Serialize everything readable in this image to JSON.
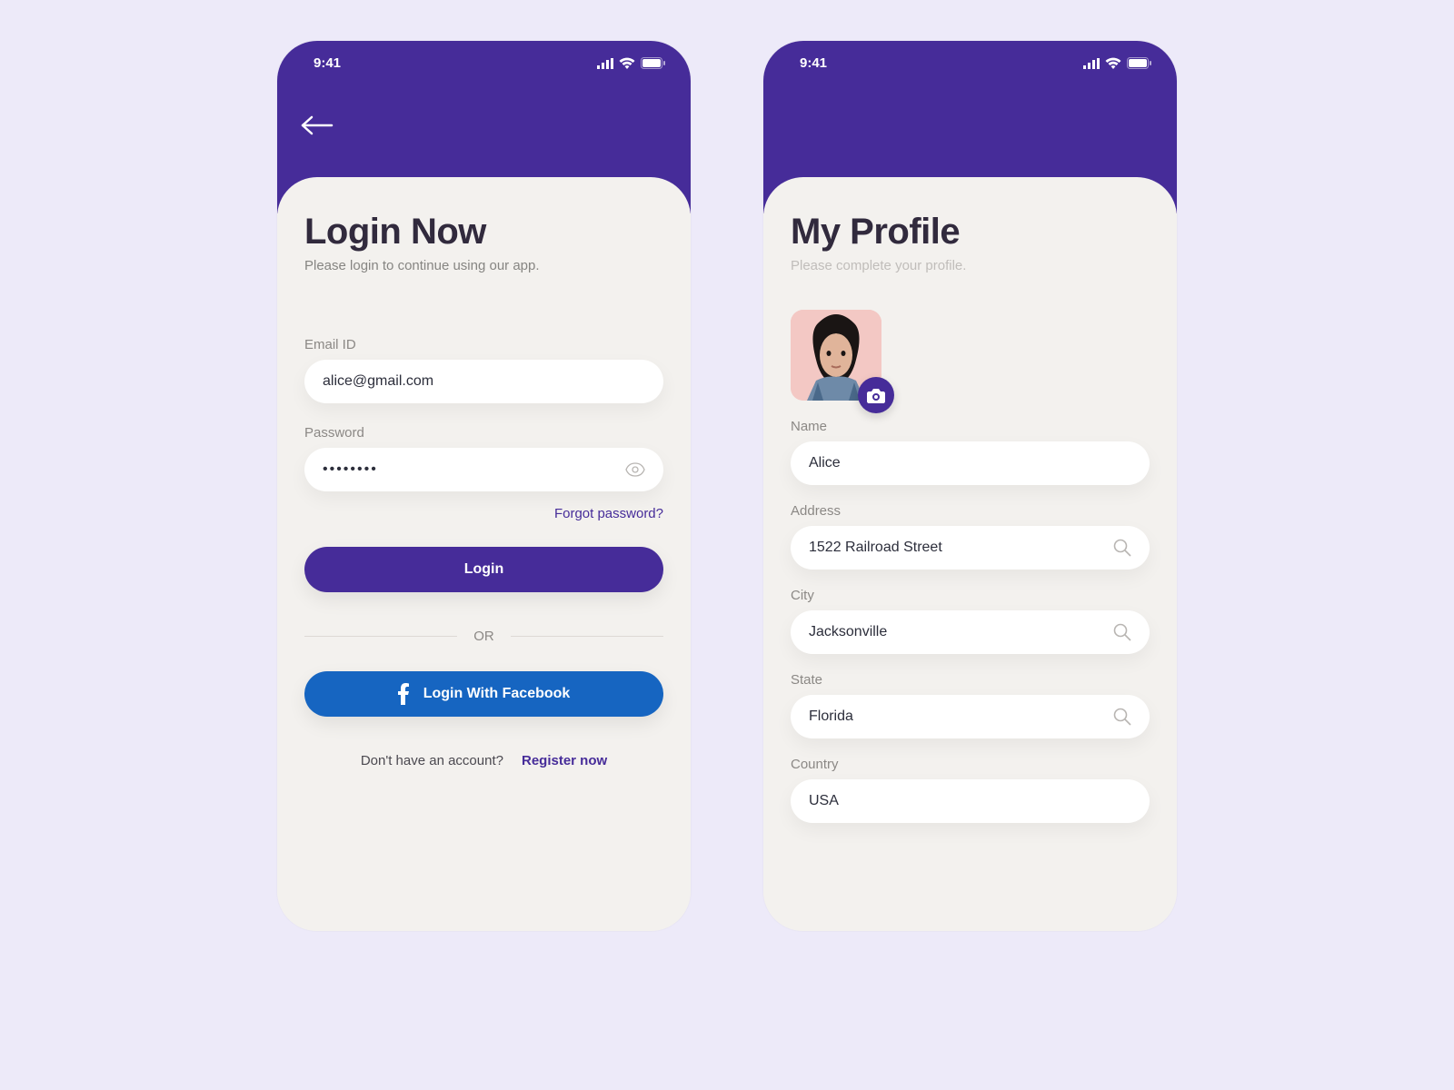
{
  "status": {
    "time": "9:41"
  },
  "login": {
    "title": "Login Now",
    "subtitle": "Please login to continue using our app.",
    "email_label": "Email ID",
    "email_value": "alice@gmail.com",
    "password_label": "Password",
    "password_value": "••••••••",
    "forgot": "Forgot password?",
    "login_btn": "Login",
    "or": "OR",
    "fb_btn": "Login With Facebook",
    "register_q": "Don't have an account?",
    "register_link": "Register now"
  },
  "profile": {
    "title": "My Profile",
    "subtitle": "Please complete your profile.",
    "name_label": "Name",
    "name_value": "Alice",
    "address_label": "Address",
    "address_value": "1522  Railroad Street",
    "city_label": "City",
    "city_value": "Jacksonville",
    "state_label": "State",
    "state_value": "Florida",
    "country_label": "Country",
    "country_value": "USA"
  }
}
